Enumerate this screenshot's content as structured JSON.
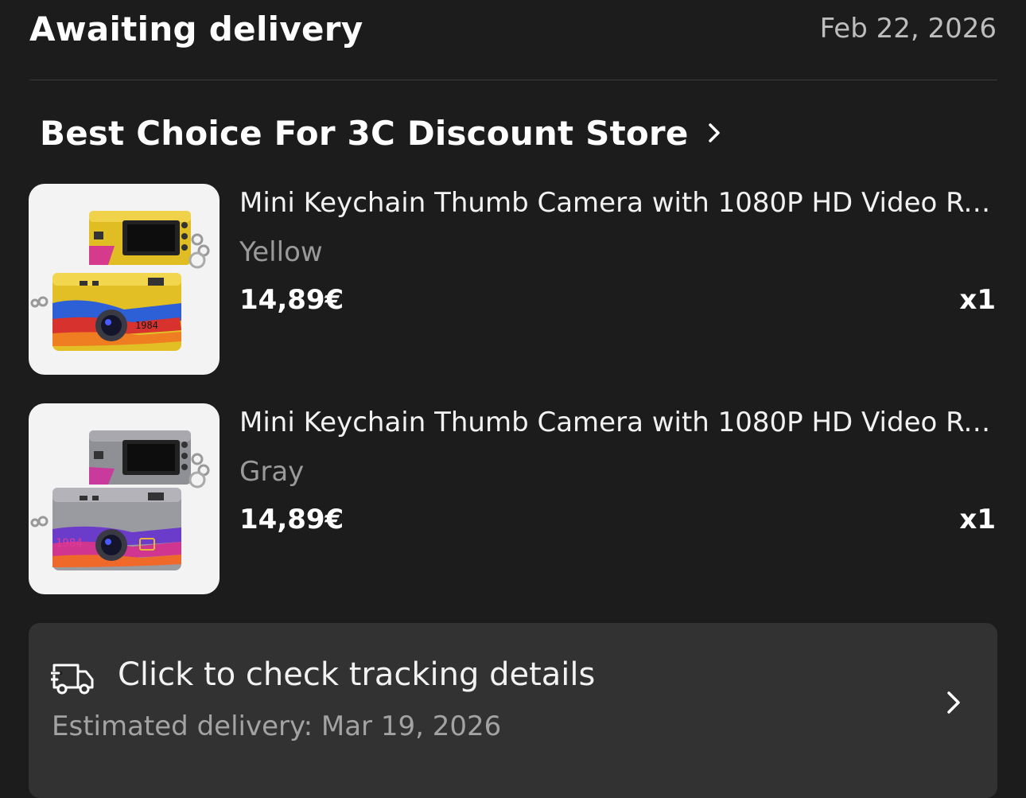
{
  "order": {
    "status": "Awaiting delivery",
    "date": "Feb 22, 2026"
  },
  "store": {
    "name": "Best Choice For 3C Discount Store",
    "chevron_icon": "chevron-right-icon"
  },
  "items": [
    {
      "title": "Mini Keychain Thumb Camera with 1080P HD Video Rec...",
      "variant": "Yellow",
      "price": "14,89€",
      "qty": "x1",
      "image_color": "#e6c52a"
    },
    {
      "title": "Mini Keychain Thumb Camera with 1080P HD Video Rec...",
      "variant": "Gray",
      "price": "14,89€",
      "qty": "x1",
      "image_color": "#9c9ca3"
    }
  ],
  "tracking": {
    "title": "Click to check tracking details",
    "eta": "Estimated delivery: Mar 19, 2026",
    "icon": "delivery-truck-icon"
  },
  "colors": {
    "background": "#1c1c1d",
    "card": "#323233",
    "muted_text": "#9a9a9a"
  }
}
